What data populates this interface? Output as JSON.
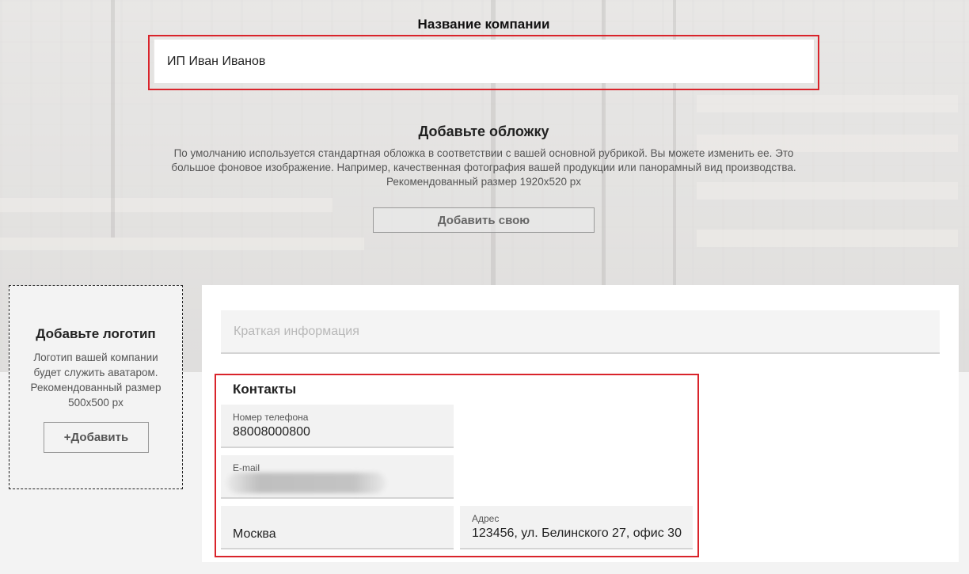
{
  "company": {
    "label": "Название компании",
    "value": "ИП Иван Иванов"
  },
  "cover": {
    "title": "Добавьте обложку",
    "description_lines": [
      "По умолчанию используется стандартная обложка в соответствии с вашей основной рубрикой. Вы можете изменить ее. Это",
      "большое фоновое изображение. Например, качественная фотография вашей продукции или панорамный вид производства.",
      "Рекомендованный размер 1920x520 px"
    ],
    "button_label": "Добавить свою"
  },
  "logo": {
    "title": "Добавьте логотип",
    "description_lines": [
      "Логотип вашей компании",
      "будет служить аватаром.",
      "Рекомендованный размер",
      "500x500 px"
    ],
    "button_label": "+Добавить"
  },
  "brief": {
    "placeholder": "Краткая информация"
  },
  "contacts": {
    "title": "Контакты",
    "phone": {
      "label": "Номер телефона",
      "value": "88008000800"
    },
    "email": {
      "label": "E-mail",
      "value": ""
    },
    "city": {
      "value": "Москва"
    },
    "address": {
      "label": "Адрес",
      "value": "123456, ул. Белинского 27, офис 30"
    }
  },
  "colors": {
    "highlight_border": "#d9242b",
    "panel_background": "#ffffff",
    "field_background": "#f2f2f2"
  }
}
